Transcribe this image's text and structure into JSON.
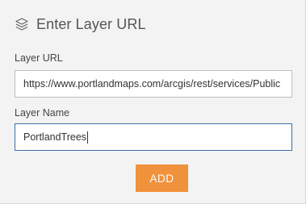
{
  "dialog": {
    "title": "Enter Layer URL",
    "icon": "layers-icon"
  },
  "layer_url": {
    "label": "Layer URL",
    "value": "https://www.portlandmaps.com/arcgis/rest/services/Public"
  },
  "layer_name": {
    "label": "Layer Name",
    "value": "PortlandTrees"
  },
  "actions": {
    "add_label": "ADD"
  },
  "colors": {
    "accent": "#f0923b",
    "focus_border": "#3a6ea5",
    "background": "#f3f3f3"
  }
}
